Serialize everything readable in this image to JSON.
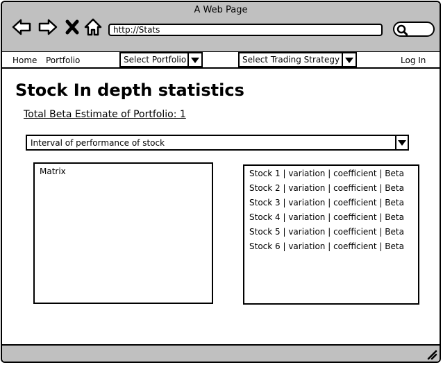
{
  "window": {
    "title": "A Web Page"
  },
  "toolbar": {
    "url": "http://Stats",
    "icons": [
      "back-arrow-icon",
      "forward-arrow-icon",
      "close-x-icon",
      "home-icon",
      "search-icon"
    ]
  },
  "menu": {
    "home": "Home",
    "portfolio": "Portfolio",
    "select_portfolio": "Select Portfolio",
    "select_strategy": "Select Trading Strategy",
    "login": "Log In"
  },
  "main": {
    "title": "Stock In depth statistics",
    "beta_estimate": "Total Beta Estimate of Portfolio: 1",
    "interval_dropdown": "Interval of performance of stock",
    "matrix_label": "Matrix",
    "stocks": [
      "Stock 1 | variation | coefficient | Beta",
      "Stock 2 | variation | coefficient | Beta",
      "Stock 3 | variation | coefficient | Beta",
      "Stock 4 | variation | coefficient | Beta",
      "Stock 5 | variation | coefficient | Beta",
      "Stock 6 | variation | coefficient | Beta"
    ]
  },
  "colors": {
    "chrome": "#c0c0c0",
    "border": "#000000",
    "background": "#ffffff"
  }
}
